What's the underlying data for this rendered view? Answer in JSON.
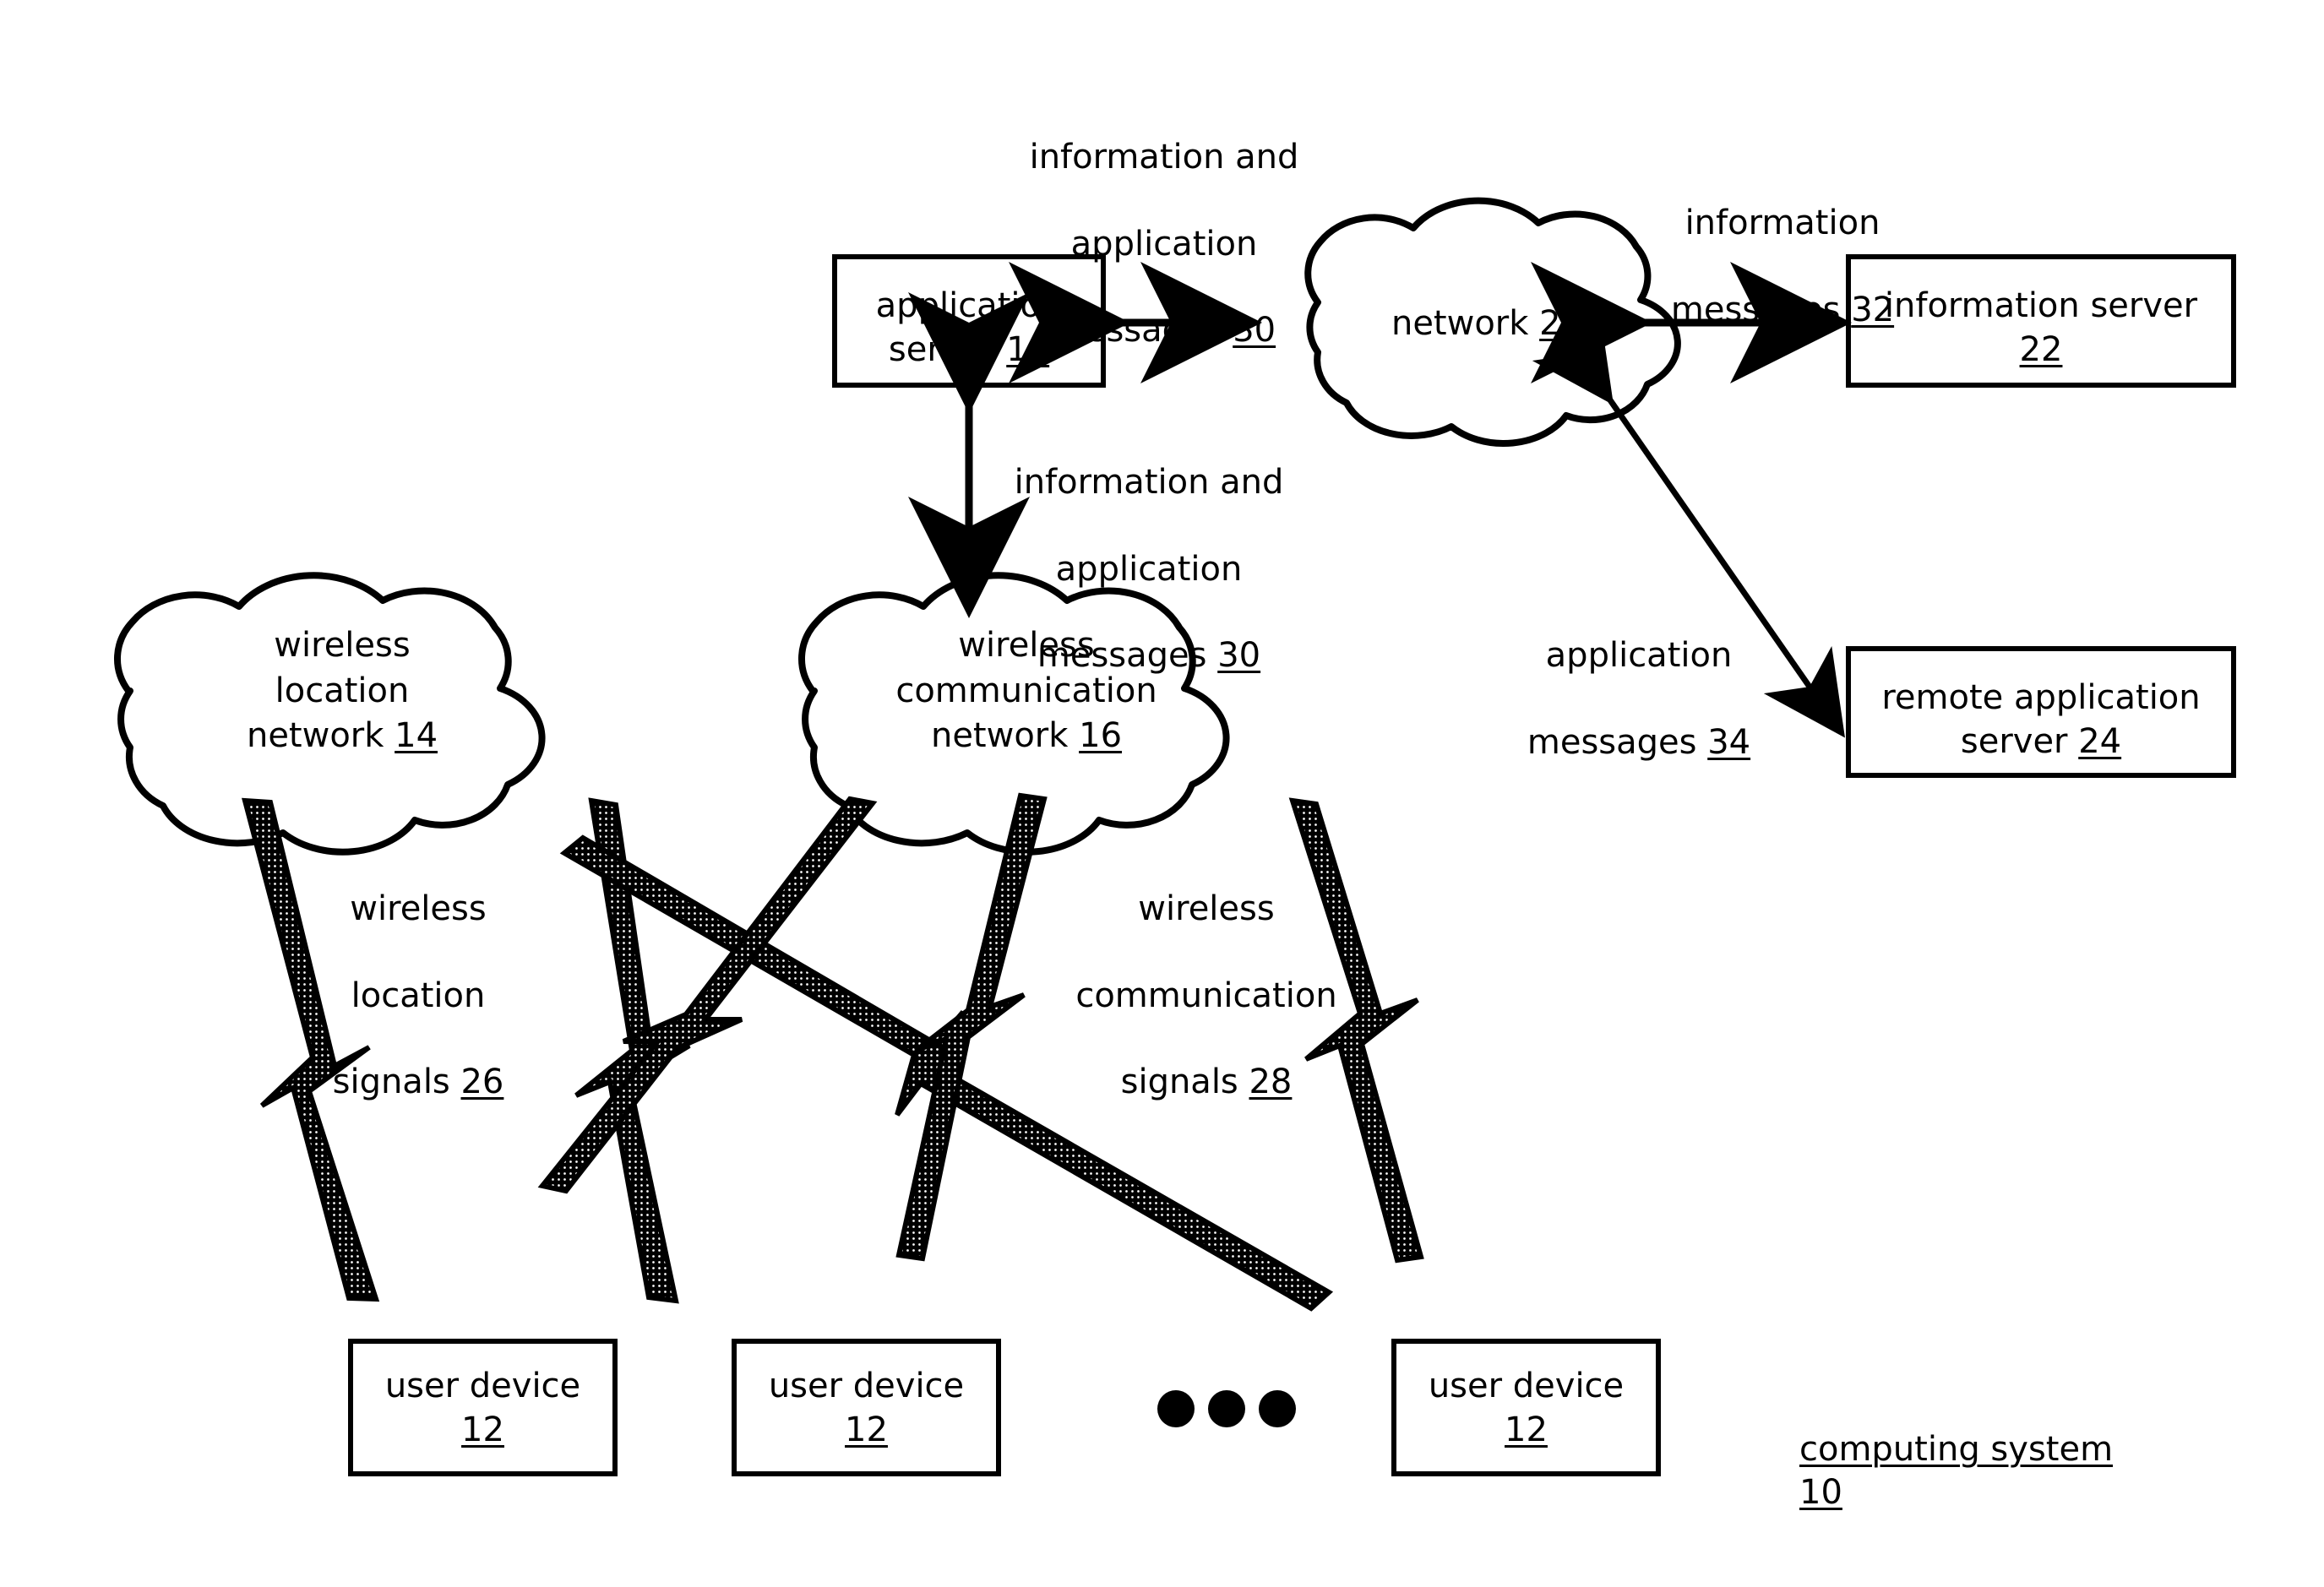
{
  "figure": {
    "caption_label": "computing system",
    "caption_ref": "10"
  },
  "nodes": {
    "application_server": {
      "line1": "application",
      "line2": "server ",
      "ref": "18"
    },
    "information_server": {
      "line1": "information server",
      "line2": "",
      "ref": "22"
    },
    "remote_application_server": {
      "line1": "remote application",
      "line2": "server ",
      "ref": "24"
    },
    "network_cloud": {
      "line1": "network ",
      "ref": "20"
    },
    "wireless_location_network": {
      "line1": "wireless",
      "line2": "location",
      "line3": "network ",
      "ref": "14"
    },
    "wireless_communication_network": {
      "line1": "wireless",
      "line2": "communication",
      "line3": "network ",
      "ref": "16"
    },
    "user_device_1": {
      "line1": "user device",
      "ref": "12"
    },
    "user_device_2": {
      "line1": "user device",
      "ref": "12"
    },
    "user_device_3": {
      "line1": "user device",
      "ref": "12"
    },
    "ellipsis": "•••"
  },
  "edge_labels": {
    "app_server_to_network": {
      "line1": "information and",
      "line2": "application",
      "line3": "messages ",
      "ref": "30"
    },
    "network_to_information_server": {
      "line1": "information",
      "line2": "messages ",
      "ref": "32"
    },
    "app_server_to_wireless_comm": {
      "line1": "information and",
      "line2": "application",
      "line3": "messages ",
      "ref": "30"
    },
    "network_to_remote_app_server": {
      "line1": "application",
      "line2": "messages ",
      "ref": "34"
    },
    "wireless_location_signals": {
      "line1": "wireless",
      "line2": "location",
      "line3": "signals ",
      "ref": "26"
    },
    "wireless_communication_signals": {
      "line1": "wireless",
      "line2": "communication",
      "line3": "signals ",
      "ref": "28"
    }
  },
  "style": {
    "stroke": "#000000",
    "fill": "#ffffff",
    "background": "#ffffff"
  },
  "chart_data": {
    "type": "diagram",
    "title": "computing system 10",
    "nodes": [
      {
        "id": "12a",
        "label": "user device 12",
        "shape": "rect"
      },
      {
        "id": "12b",
        "label": "user device 12",
        "shape": "rect"
      },
      {
        "id": "12c",
        "label": "user device 12",
        "shape": "rect"
      },
      {
        "id": "14",
        "label": "wireless location network 14",
        "shape": "cloud"
      },
      {
        "id": "16",
        "label": "wireless communication network 16",
        "shape": "cloud"
      },
      {
        "id": "18",
        "label": "application server 18",
        "shape": "rect"
      },
      {
        "id": "20",
        "label": "network 20",
        "shape": "cloud"
      },
      {
        "id": "22",
        "label": "information server 22",
        "shape": "rect"
      },
      {
        "id": "24",
        "label": "remote application server 24",
        "shape": "rect"
      }
    ],
    "edges": [
      {
        "from": "18",
        "to": "20",
        "label": "information and application messages 30",
        "arrow": "both"
      },
      {
        "from": "20",
        "to": "22",
        "label": "information messages 32",
        "arrow": "both"
      },
      {
        "from": "18",
        "to": "16",
        "label": "information and application messages 30",
        "arrow": "both"
      },
      {
        "from": "20",
        "to": "24",
        "label": "application messages 34",
        "arrow": "both"
      },
      {
        "from": "14",
        "to": "12a",
        "label": "wireless location signals 26",
        "arrow": "lightning"
      },
      {
        "from": "14",
        "to": "12b",
        "label": "wireless location signals 26",
        "arrow": "lightning"
      },
      {
        "from": "14",
        "to": "12c",
        "label": "wireless location signals 26",
        "arrow": "lightning"
      },
      {
        "from": "16",
        "to": "12a",
        "label": "wireless communication signals 28",
        "arrow": "lightning"
      },
      {
        "from": "16",
        "to": "12b",
        "label": "wireless communication signals 28",
        "arrow": "lightning"
      },
      {
        "from": "16",
        "to": "12c",
        "label": "wireless communication signals 28",
        "arrow": "lightning"
      }
    ]
  }
}
